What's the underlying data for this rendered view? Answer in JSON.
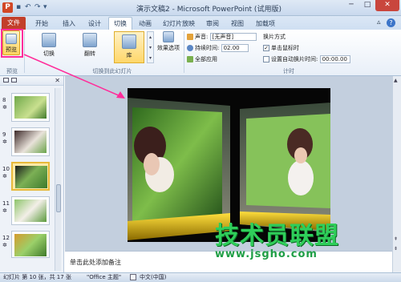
{
  "window": {
    "title": "演示文稿2 - Microsoft PowerPoint (试用版)",
    "minimize": "─",
    "maximize": "□",
    "close": "✕"
  },
  "tabs": {
    "file": "文件",
    "items": [
      "开始",
      "插入",
      "设计",
      "切换",
      "动画",
      "幻灯片放映",
      "审阅",
      "视图",
      "加载项"
    ],
    "active_index": 3
  },
  "ribbon": {
    "preview_label": "预览",
    "preview_group": "预览",
    "transitions": [
      "切换",
      "翻转",
      "库"
    ],
    "transitions_group": "切换到此幻灯片",
    "effect_options": "效果选项",
    "sound_label": "声音:",
    "sound_value": "[无声音]",
    "duration_label": "持续时间:",
    "duration_value": "02.00",
    "apply_all": "全部应用",
    "advance_title": "换片方式",
    "on_click": "单击鼠标时",
    "after_label": "设置自动换片时间:",
    "after_value": "00:00.00",
    "timing_group": "计时"
  },
  "slides_panel": {
    "slides": [
      {
        "num": "8",
        "mark": "✲"
      },
      {
        "num": "9",
        "mark": "✲"
      },
      {
        "num": "10",
        "mark": "✲",
        "selected": true
      },
      {
        "num": "11",
        "mark": "✲"
      },
      {
        "num": "12",
        "mark": "✲"
      }
    ]
  },
  "notes": {
    "placeholder": "单击此处添加备注"
  },
  "status": {
    "slide_info": "幻灯片 第 10 张，共 17 张",
    "theme": "\"Office 主题\"",
    "language": "中文(中国)"
  },
  "watermark": {
    "title": "技术员联盟",
    "url": "www.jsgho.com"
  },
  "colors": {
    "accent": "#ff2d9a",
    "file_tab": "#c23f2a",
    "highlight": "#ffd76a",
    "watermark": "#2fce5a"
  },
  "icons": [
    "app-logo-icon",
    "save-icon",
    "undo-icon",
    "redo-icon",
    "preview-icon",
    "transition-cut-icon",
    "transition-flip-icon",
    "transition-gallery-icon",
    "effect-options-icon",
    "sound-icon",
    "clock-icon",
    "apply-all-icon",
    "help-icon"
  ]
}
